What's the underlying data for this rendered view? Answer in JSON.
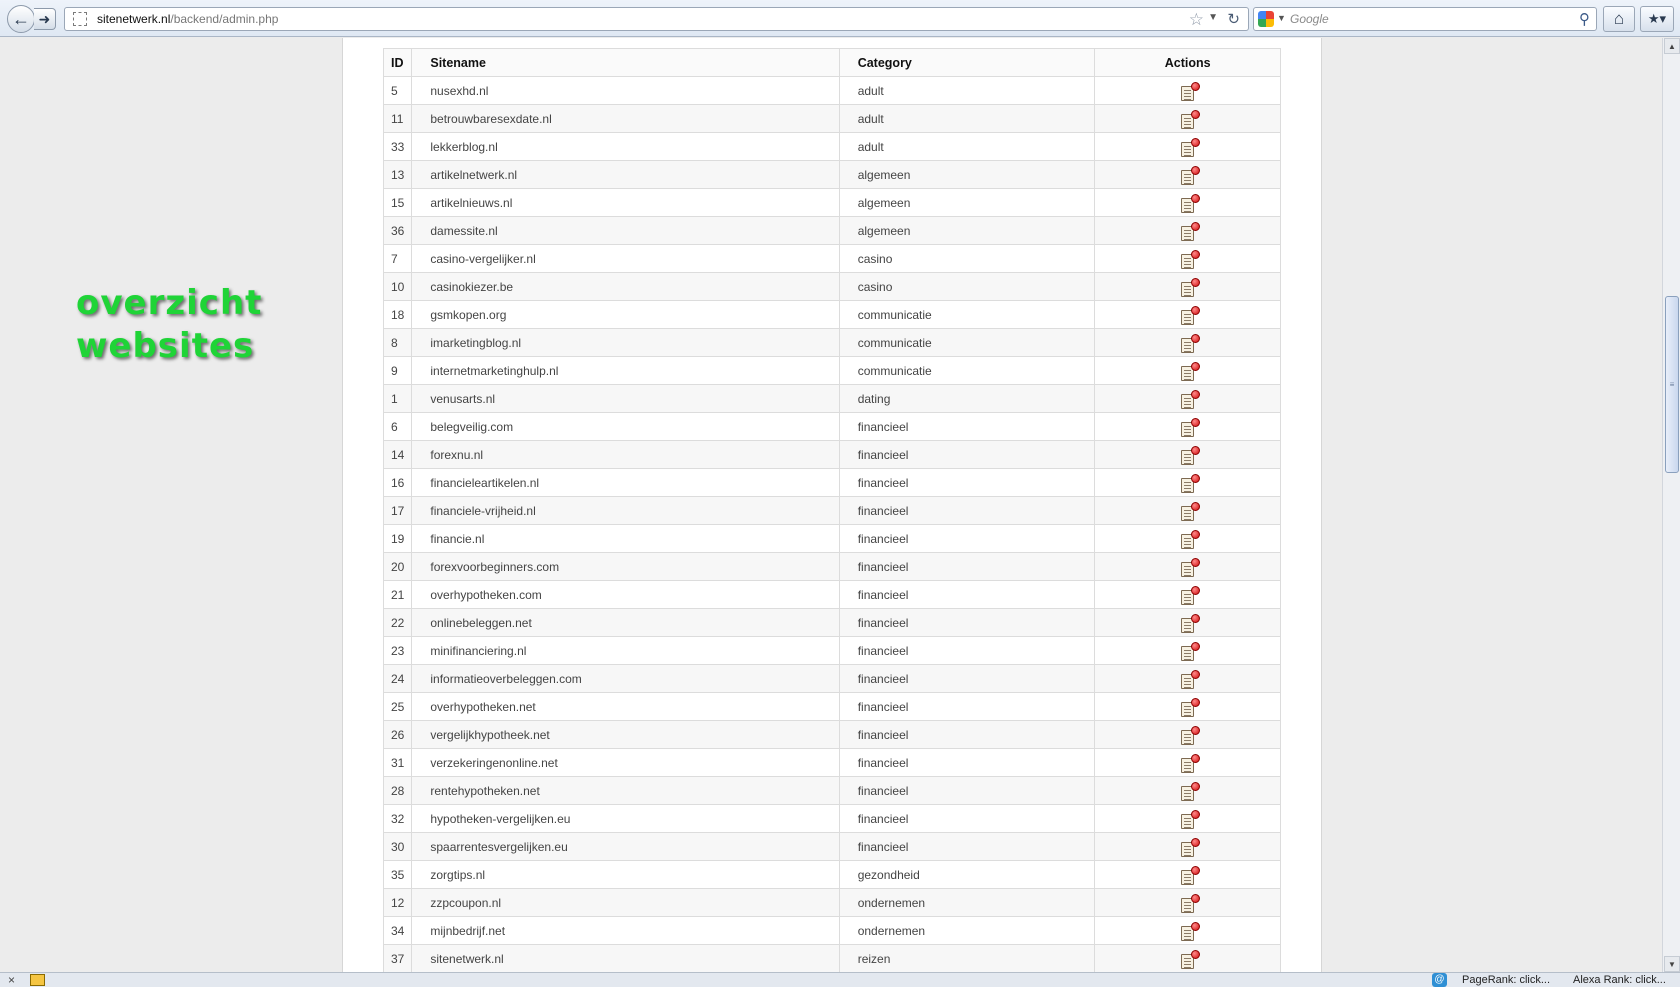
{
  "browser": {
    "url_host": "sitenetwerk.nl",
    "url_path": "/backend/admin.php",
    "search_placeholder": "Google"
  },
  "page": {
    "side_heading_line1": "overzicht",
    "side_heading_line2": "websites"
  },
  "table": {
    "headers": {
      "id": "ID",
      "sitename": "Sitename",
      "category": "Category",
      "actions": "Actions"
    },
    "rows": [
      {
        "id": "5",
        "name": "nusexhd.nl",
        "category": "adult"
      },
      {
        "id": "11",
        "name": "betrouwbaresexdate.nl",
        "category": "adult"
      },
      {
        "id": "33",
        "name": "lekkerblog.nl",
        "category": "adult"
      },
      {
        "id": "13",
        "name": "artikelnetwerk.nl",
        "category": "algemeen"
      },
      {
        "id": "15",
        "name": "artikelnieuws.nl",
        "category": "algemeen"
      },
      {
        "id": "36",
        "name": "damessite.nl",
        "category": "algemeen"
      },
      {
        "id": "7",
        "name": "casino-vergelijker.nl",
        "category": "casino"
      },
      {
        "id": "10",
        "name": "casinokiezer.be",
        "category": "casino"
      },
      {
        "id": "18",
        "name": "gsmkopen.org",
        "category": "communicatie"
      },
      {
        "id": "8",
        "name": "imarketingblog.nl",
        "category": "communicatie"
      },
      {
        "id": "9",
        "name": "internetmarketinghulp.nl",
        "category": "communicatie"
      },
      {
        "id": "1",
        "name": "venusarts.nl",
        "category": "dating"
      },
      {
        "id": "6",
        "name": "belegveilig.com",
        "category": "financieel"
      },
      {
        "id": "14",
        "name": "forexnu.nl",
        "category": "financieel"
      },
      {
        "id": "16",
        "name": "financieleartikelen.nl",
        "category": "financieel"
      },
      {
        "id": "17",
        "name": "financiele-vrijheid.nl",
        "category": "financieel"
      },
      {
        "id": "19",
        "name": "financie.nl",
        "category": "financieel"
      },
      {
        "id": "20",
        "name": "forexvoorbeginners.com",
        "category": "financieel"
      },
      {
        "id": "21",
        "name": "overhypotheken.com",
        "category": "financieel"
      },
      {
        "id": "22",
        "name": "onlinebeleggen.net",
        "category": "financieel"
      },
      {
        "id": "23",
        "name": "minifinanciering.nl",
        "category": "financieel"
      },
      {
        "id": "24",
        "name": "informatieoverbeleggen.com",
        "category": "financieel"
      },
      {
        "id": "25",
        "name": "overhypotheken.net",
        "category": "financieel"
      },
      {
        "id": "26",
        "name": "vergelijkhypotheek.net",
        "category": "financieel"
      },
      {
        "id": "31",
        "name": "verzekeringenonline.net",
        "category": "financieel"
      },
      {
        "id": "28",
        "name": "rentehypotheken.net",
        "category": "financieel"
      },
      {
        "id": "32",
        "name": "hypotheken-vergelijken.eu",
        "category": "financieel"
      },
      {
        "id": "30",
        "name": "spaarrentesvergelijken.eu",
        "category": "financieel"
      },
      {
        "id": "35",
        "name": "zorgtips.nl",
        "category": "gezondheid"
      },
      {
        "id": "12",
        "name": "zzpcoupon.nl",
        "category": "ondernemen"
      },
      {
        "id": "34",
        "name": "mijnbedrijf.net",
        "category": "ondernemen"
      },
      {
        "id": "37",
        "name": "sitenetwerk.nl",
        "category": "reizen"
      }
    ]
  },
  "statusbar": {
    "pagerank": "PageRank: click...",
    "alexa": "Alexa Rank: click..."
  },
  "icons": {
    "action": "delete-document-icon"
  }
}
